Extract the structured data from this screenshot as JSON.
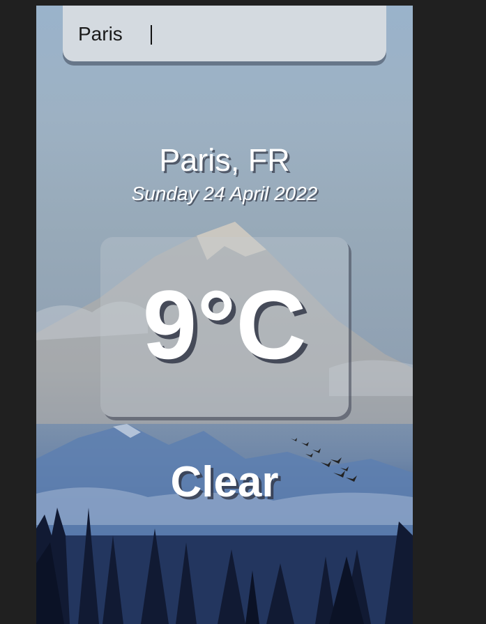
{
  "search": {
    "value": "Paris",
    "placeholder": ""
  },
  "weather": {
    "location": "Paris, FR",
    "date": "Sunday 24 April 2022",
    "temperature": "9°C",
    "condition": "Clear"
  },
  "icons": {
    "background": "mountain-forest-landscape",
    "birds": "flying-birds-illustration"
  },
  "colors": {
    "window_background": "#202020",
    "search_box": "#d4dae0",
    "text": "#ffffff"
  }
}
